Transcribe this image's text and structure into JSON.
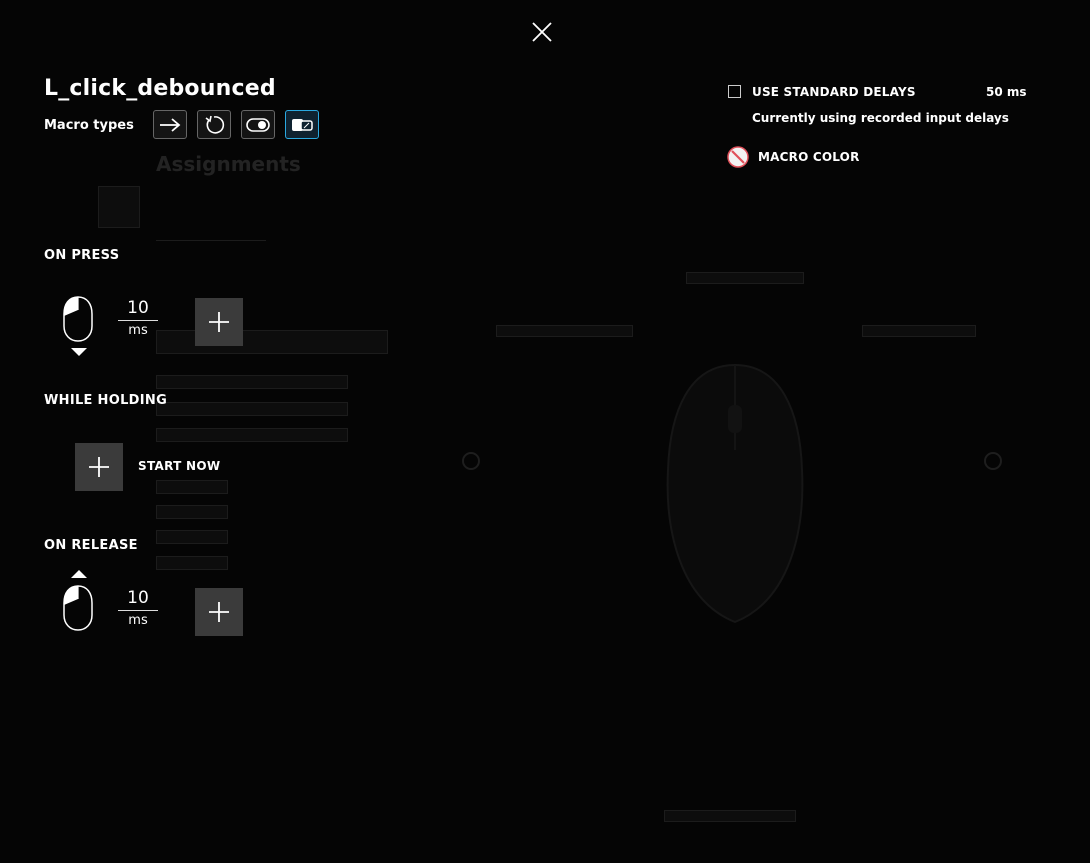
{
  "macro": {
    "name": "L_click_debounced",
    "types_label": "Macro types",
    "types": [
      {
        "icon": "arrow-right-icon",
        "active": false
      },
      {
        "icon": "repeat-icon",
        "active": false
      },
      {
        "icon": "toggle-icon",
        "active": false
      },
      {
        "icon": "sequence-icon",
        "active": true
      }
    ]
  },
  "sections": {
    "on_press": {
      "label": "ON PRESS",
      "delay": "10",
      "unit": "ms"
    },
    "while_holding": {
      "label": "WHILE HOLDING",
      "start_label": "START NOW"
    },
    "on_release": {
      "label": "ON RELEASE",
      "delay": "10",
      "unit": "ms"
    }
  },
  "settings": {
    "standard_delays_label": "USE STANDARD DELAYS",
    "standard_delays_value": "50 ms",
    "standard_delays_checked": false,
    "status_text": "Currently using recorded input delays",
    "macro_color_label": "MACRO COLOR"
  },
  "colors": {
    "accent": "#2aa8e0",
    "button_bg": "#3b3b3b",
    "swatch_ring": "#e0505a"
  }
}
